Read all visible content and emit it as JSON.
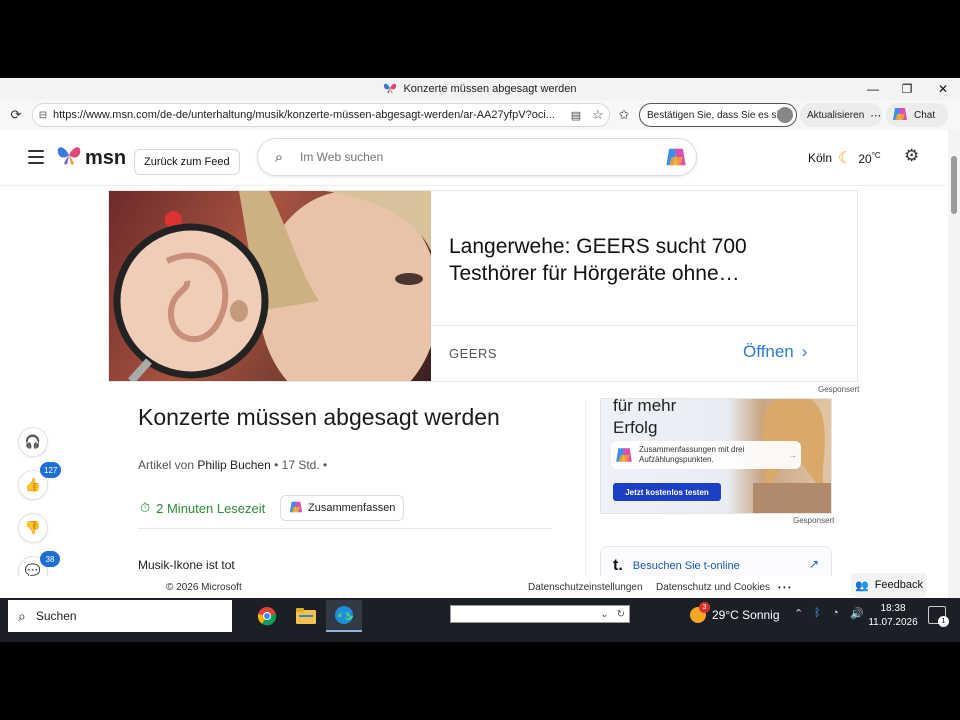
{
  "window": {
    "title": "Konzerte müssen abgesagt werden",
    "minimize": "—",
    "restore": "❐",
    "close": "✕"
  },
  "address_bar": {
    "url": "https://www.msn.com/de-de/unterhaltung/musik/konzerte-müssen-abgesagt-werden/ar-AA27yfpV?oci...",
    "verify_label": "Bestätigen Sie, dass Sie es sind",
    "update_label": "Aktualisieren",
    "chat_label": "Chat"
  },
  "msn_header": {
    "logo_text": "msn",
    "back_label": "Zurück zum Feed",
    "search_placeholder": "Im Web suchen",
    "city": "Köln",
    "temperature": "20",
    "temp_unit": "°C"
  },
  "ad_banner": {
    "title": "Langerwehe: GEERS sucht 700 Testhörer für Hörgeräte ohne…",
    "brand": "GEERS",
    "open_label": "Öffnen",
    "sponsored": "Gesponsert"
  },
  "left_rail": {
    "like_count": "127",
    "comment_count": "38"
  },
  "article": {
    "title": "Konzerte müssen abgesagt werden",
    "byline_prefix": "Artikel von",
    "author": "Philip Buchen",
    "age": "• 17 Std. •",
    "read_time": "2 Minuten Lesezeit",
    "summarize_label": "Zusammenfassen",
    "intro": "Musik-Ikone ist tot"
  },
  "side_ad": {
    "headline_1": "für mehr",
    "headline_2": "Erfolg",
    "chip_text": "Zusammenfassungen mit drei Aufzählungspunkten.",
    "cta": "Jetzt kostenlos testen",
    "sponsored": "Gesponsert"
  },
  "tonline": {
    "mark": "t.",
    "label": "Besuchen Sie t-online"
  },
  "footer": {
    "copyright": "© 2026 Microsoft",
    "privacy_settings": "Datenschutzeinstellungen",
    "privacy_cookies": "Datenschutz und Cookies",
    "more": "• • •",
    "feedback": "Feedback"
  },
  "taskbar": {
    "search_label": "Suchen",
    "weather_badge": "3",
    "weather": "29°C  Sonnig",
    "time": "18:38",
    "date": "11.07.2026",
    "notification_count": "1"
  },
  "colors": {
    "accent_blue": "#1d6fd3",
    "read_time_green": "#2e8b3a",
    "link_blue": "#2e7ad1",
    "taskbar_bg": "#1b1f26"
  }
}
